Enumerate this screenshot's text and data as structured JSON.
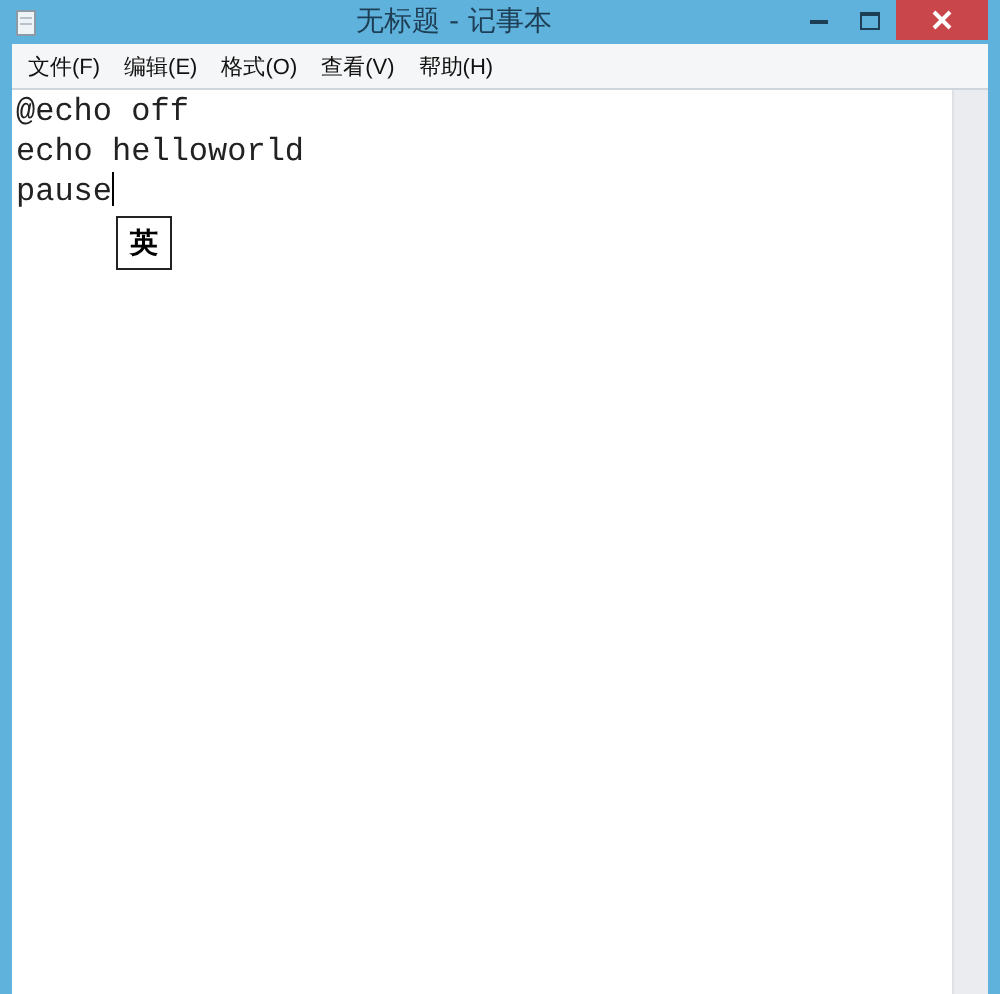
{
  "window": {
    "title": "无标题 - 记事本"
  },
  "menu": [
    "文件(F)",
    "编辑(E)",
    "格式(O)",
    "查看(V)",
    "帮助(H)"
  ],
  "editor": {
    "lines": [
      "@echo off",
      "echo helloworld",
      "pause"
    ]
  },
  "ime_indicator": {
    "label": "英"
  }
}
